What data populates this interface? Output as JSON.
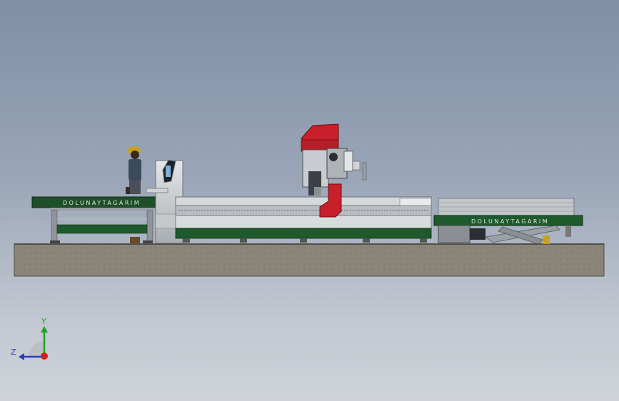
{
  "scene": {
    "brand_text_left": "DOLUNAYTAGARIM",
    "brand_text_right": "DOLUNAYTAGARIM",
    "accent_red": "#c8202a",
    "frame_green": "#1f5a2c",
    "floor_color": "#8a8578"
  },
  "triad": {
    "y_label": "Y",
    "z_label": "Z",
    "y_color": "#1fa22c",
    "z_color": "#2a3fb8",
    "x_color": "#d12020"
  }
}
